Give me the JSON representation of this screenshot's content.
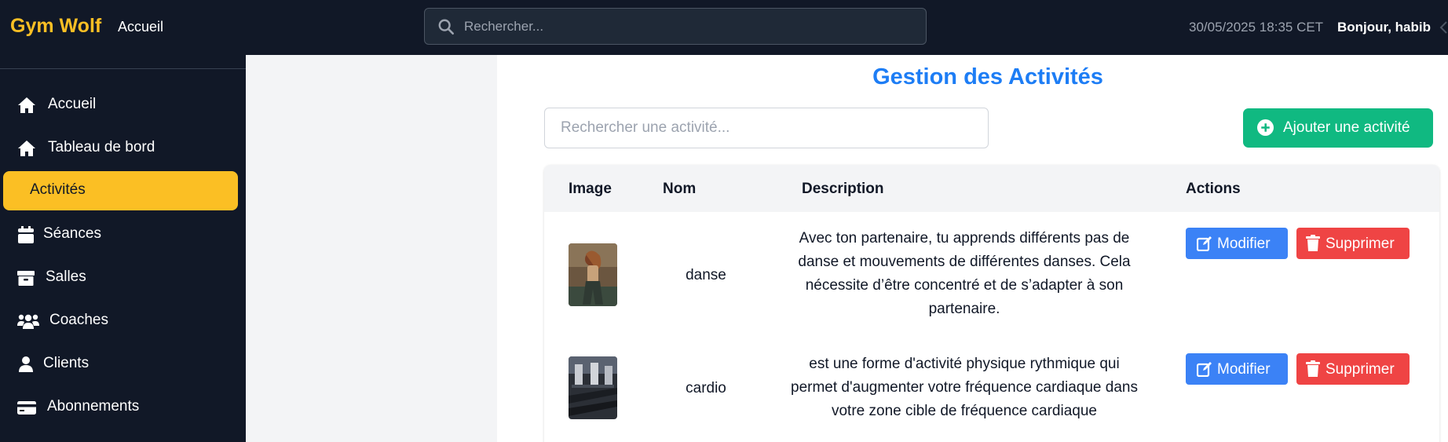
{
  "topbar": {
    "brand": "Gym Wolf",
    "home_link": "Accueil",
    "search_placeholder": "Rechercher...",
    "datetime": "30/05/2025 18:35 CET",
    "greeting": "Bonjour, habib"
  },
  "sidebar": {
    "items": [
      {
        "label": "Accueil",
        "icon": "home-icon",
        "active": false
      },
      {
        "label": "Tableau de bord",
        "icon": "home-icon",
        "active": false
      },
      {
        "label": "Activités",
        "icon": "",
        "active": true
      },
      {
        "label": "Séances",
        "icon": "calendar-icon",
        "active": false
      },
      {
        "label": "Salles",
        "icon": "archive-icon",
        "active": false
      },
      {
        "label": "Coaches",
        "icon": "users-icon",
        "active": false
      },
      {
        "label": "Clients",
        "icon": "user-icon",
        "active": false
      },
      {
        "label": "Abonnements",
        "icon": "credit-card-icon",
        "active": false
      }
    ]
  },
  "main": {
    "title": "Gestion des Activités",
    "search_placeholder": "Rechercher une activité...",
    "add_button": "Ajouter une activité",
    "table": {
      "headers": [
        "Image",
        "Nom",
        "Description",
        "Actions"
      ],
      "rows": [
        {
          "name": "danse",
          "description": "Avec ton partenaire, tu apprends différents pas de danse et mouvements de différentes danses. Cela nécessite d’être concentré et de s’adapter à son partenaire.",
          "image": "dance-photo"
        },
        {
          "name": "cardio",
          "description": "est une forme d'activité physique rythmique qui permet d'augmenter votre fréquence cardiaque dans votre zone cible de fréquence cardiaque",
          "image": "cardio-gym-photo"
        }
      ],
      "edit_label": "Modifier",
      "delete_label": "Supprimer"
    }
  },
  "colors": {
    "topbar_bg": "#111827",
    "brand": "#fbbf24",
    "active_nav": "#fbbf24",
    "title": "#1d7df5",
    "add_button": "#10b981",
    "edit_button": "#3b82f6",
    "delete_button": "#ef4444"
  }
}
